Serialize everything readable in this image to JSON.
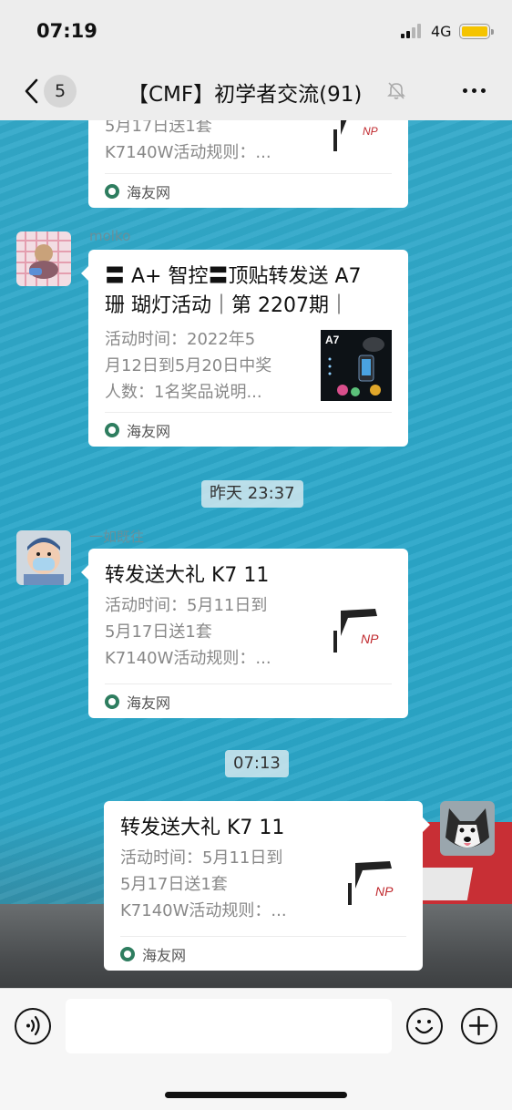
{
  "status_bar": {
    "time": "07:19",
    "network": "4G"
  },
  "nav": {
    "back_count": "5",
    "title": "【CMF】初学者交流(91)"
  },
  "messages": [
    {
      "title": "",
      "desc": "5月17日送1套\nK7140W活动规则：...",
      "desc_lines": [
        "5月17日送1套",
        "K7140W活动规则：..."
      ],
      "source": "海友网"
    },
    {
      "sender": "molko",
      "title_lines": [
        "〓 A+ 智控〓顶贴转发送 A7",
        "珊 瑚灯活动｜第 2207期｜"
      ],
      "desc_lines": [
        "活动时间：2022年5",
        "月12日到5月20日中奖",
        "人数：1名奖品说明..."
      ],
      "source": "海友网"
    },
    {
      "timestamp": "昨天 23:37"
    },
    {
      "sender": "一如既往",
      "title_lines": [
        "转发送大礼 K7 11"
      ],
      "desc_lines": [
        "活动时间：5月11日到",
        "5月17日送1套",
        "K7140W活动规则：..."
      ],
      "source": "海友网"
    },
    {
      "timestamp": "07:13"
    },
    {
      "title_lines": [
        "转发送大礼 K7 11"
      ],
      "desc_lines": [
        "活动时间：5月11日到",
        "5月17日送1套",
        "K7140W活动规则：..."
      ],
      "source": "海友网"
    }
  ],
  "thumb_texts": {
    "a7_label": "A7",
    "np_label": "NP"
  },
  "icons": {
    "back": "chevron-left-icon",
    "mute": "bell-slash-icon",
    "more": "more-dots-icon",
    "voice": "voice-icon",
    "emoji": "emoji-icon",
    "plus": "plus-icon"
  },
  "colors": {
    "chat_bg": "#2ca6c7",
    "card_bg": "#ffffff",
    "bar_bg": "#ededed"
  }
}
